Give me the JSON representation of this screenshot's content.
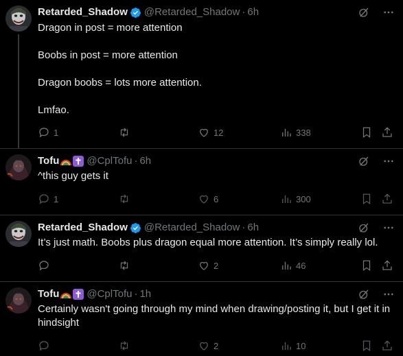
{
  "colors": {
    "background": "#000000",
    "text_primary": "#e7e9ea",
    "text_secondary": "#71767b",
    "verified": "#1d9bf0",
    "divider": "#2f3336"
  },
  "posts": [
    {
      "author_name": "Retarded_Shadow",
      "verified": true,
      "handle": "@Retarded_Shadow",
      "separator": "·",
      "time": "6h",
      "text": "Dragon in post = more attention\n\nBoobs in post = more attention\n\nDragon boobs = lots more attention.\n\nLmfao.",
      "replies": "1",
      "reposts": "",
      "likes": "12",
      "views": "338",
      "icons": [
        "reply-icon",
        "repost-icon",
        "like-icon",
        "views-icon",
        "bookmark-icon",
        "share-icon",
        "grok-icon",
        "more-icon"
      ]
    },
    {
      "author_name": "Tofu",
      "badges": [
        "rainbow-emoji",
        "cross-emoji"
      ],
      "handle": "@CplTofu",
      "separator": "·",
      "time": "6h",
      "text": "^this guy gets it",
      "replies": "1",
      "reposts": "",
      "likes": "6",
      "views": "300"
    },
    {
      "author_name": "Retarded_Shadow",
      "verified": true,
      "handle": "@Retarded_Shadow",
      "separator": "·",
      "time": "6h",
      "text": "It’s just math. Boobs plus dragon equal more attention. It’s simply really lol.",
      "replies": "",
      "reposts": "",
      "likes": "2",
      "views": "46"
    },
    {
      "author_name": "Tofu",
      "badges": [
        "rainbow-emoji",
        "cross-emoji"
      ],
      "handle": "@CplTofu",
      "separator": "·",
      "time": "1h",
      "text": "Certainly wasn't going through my mind when drawing/posting it, but I get it in hindsight",
      "replies": "",
      "reposts": "",
      "likes": "2",
      "views": "10"
    }
  ]
}
